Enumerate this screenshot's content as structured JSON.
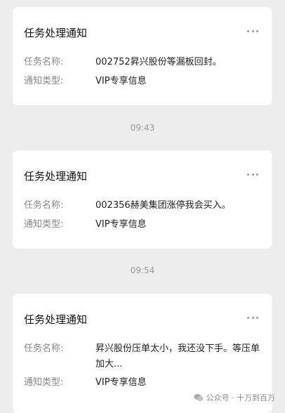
{
  "messages": [
    {
      "title": "任务处理通知",
      "task_label": "任务名称:",
      "task_value": "002752昇兴股份等漏板回封。",
      "type_label": "通知类型:",
      "type_value": "VIP专享信息"
    },
    {
      "title": "任务处理通知",
      "task_label": "任务名称:",
      "task_value": "002356赫美集团涨停我会买入。",
      "type_label": "通知类型:",
      "type_value": "VIP专享信息"
    },
    {
      "title": "任务处理通知",
      "task_label": "任务名称:",
      "task_value": "昇兴股份压单太小，我还没下手。等压单加大...",
      "type_label": "通知类型:",
      "type_value": "VIP专享信息"
    }
  ],
  "timestamps": [
    "09:43",
    "09:54"
  ],
  "watermark": {
    "text": "公众号 · 十万到百万",
    "icon": "wechat-icon"
  },
  "colors": {
    "background": "#ededed",
    "card": "#ffffff",
    "label": "#888888",
    "timestamp": "#9a9a9a"
  }
}
